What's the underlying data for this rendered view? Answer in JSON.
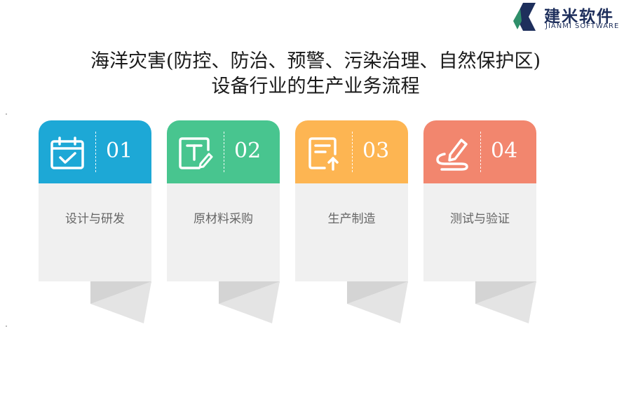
{
  "logo": {
    "name_cn": "建米软件",
    "name_en": "JIANMI SOFTWARE"
  },
  "title_line1": "海洋灾害(防控、防治、预警、污染治理、自然保护区)",
  "title_line2": "设备行业的生产业务流程",
  "steps": [
    {
      "number": "01",
      "label": "设计与研发",
      "icon": "calendar-check-icon",
      "color": "#1da8d6"
    },
    {
      "number": "02",
      "label": "原材料采购",
      "icon": "text-edit-icon",
      "color": "#48c58f"
    },
    {
      "number": "03",
      "label": "生产制造",
      "icon": "document-upload-icon",
      "color": "#fdb552"
    },
    {
      "number": "04",
      "label": "测试与验证",
      "icon": "signature-pen-icon",
      "color": "#f2866e"
    }
  ]
}
